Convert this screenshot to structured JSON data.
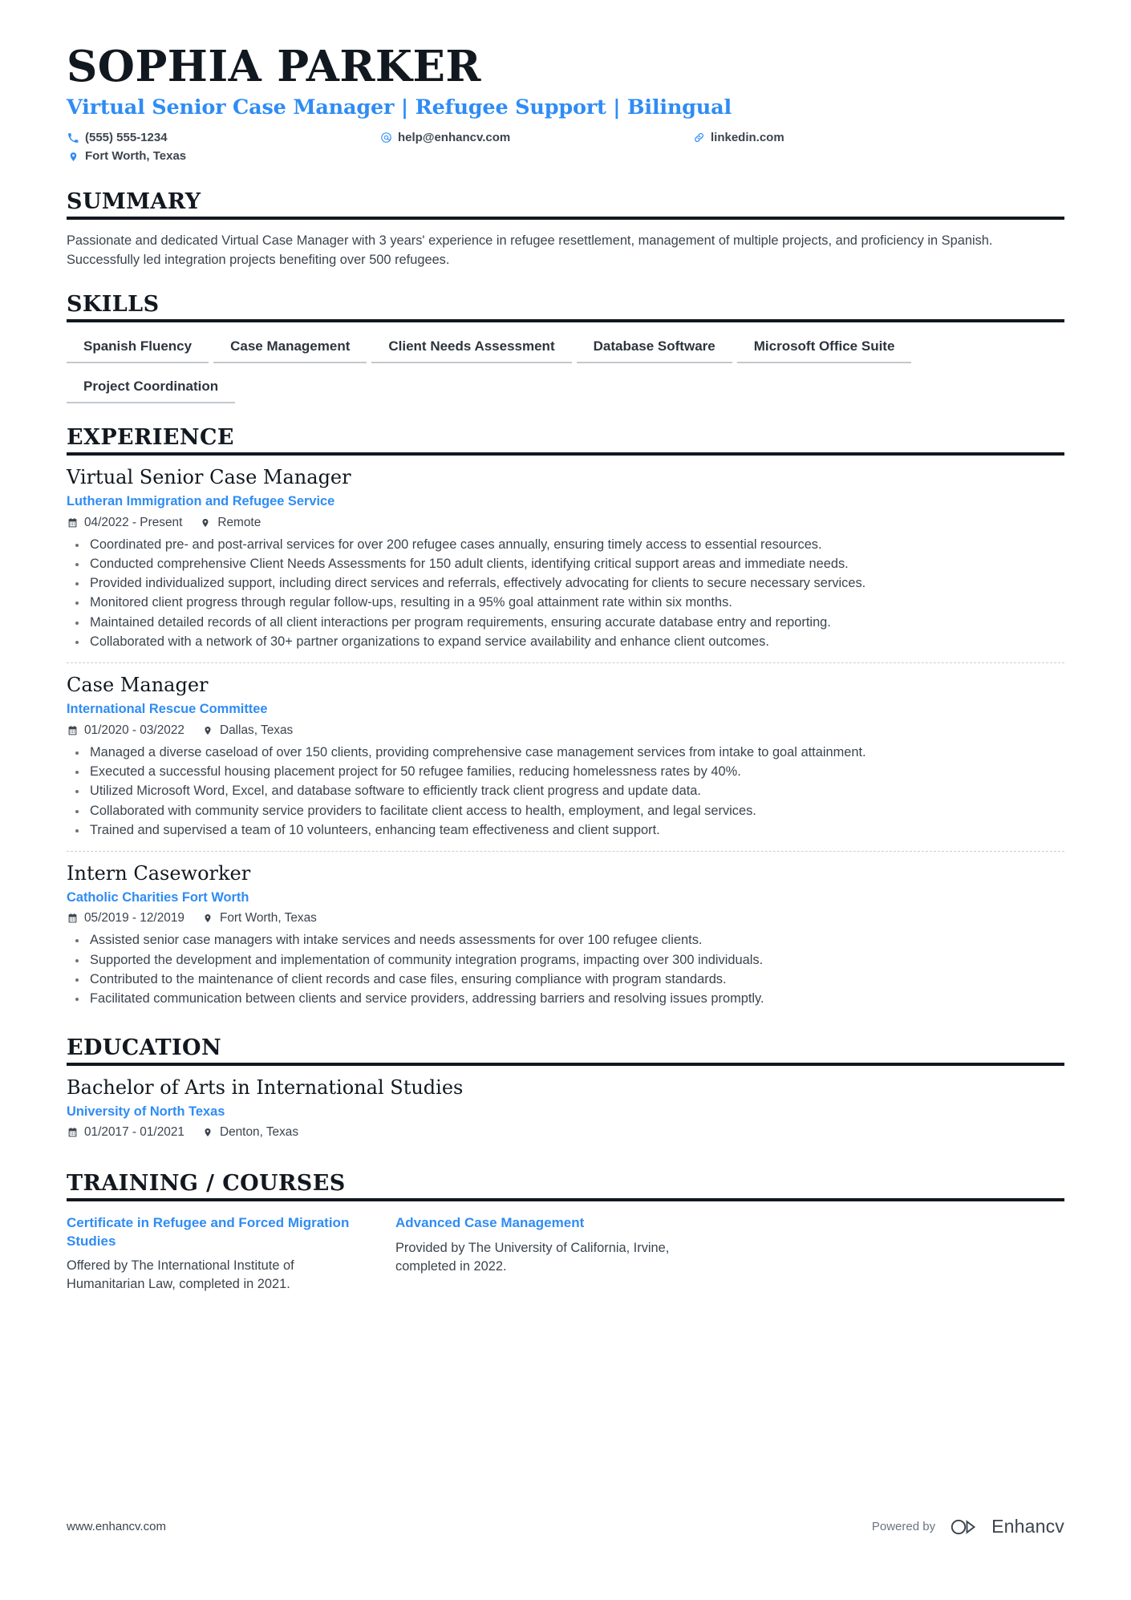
{
  "header": {
    "name": "SOPHIA PARKER",
    "headline": "Virtual Senior Case Manager | Refugee Support | Bilingual",
    "contacts": [
      {
        "icon": "phone-icon",
        "text": "(555) 555-1234"
      },
      {
        "icon": "email-icon",
        "text": "help@enhancv.com"
      },
      {
        "icon": "link-icon",
        "text": "linkedin.com"
      },
      {
        "icon": "location-icon",
        "text": "Fort Worth, Texas"
      }
    ]
  },
  "summary": {
    "title": "SUMMARY",
    "text": "Passionate and dedicated Virtual Case Manager with 3 years' experience in refugee resettlement, management of multiple projects, and proficiency in Spanish. Successfully led integration projects benefiting over 500 refugees."
  },
  "skills": {
    "title": "SKILLS",
    "items": [
      "Spanish Fluency",
      "Case Management",
      "Client Needs Assessment",
      "Database Software",
      "Microsoft Office Suite",
      "Project Coordination"
    ]
  },
  "experience": {
    "title": "EXPERIENCE",
    "entries": [
      {
        "role": "Virtual Senior Case Manager",
        "org": "Lutheran Immigration and Refugee Service",
        "dates": "04/2022 - Present",
        "location": "Remote",
        "bullets": [
          "Coordinated pre- and post-arrival services for over 200 refugee cases annually, ensuring timely access to essential resources.",
          "Conducted comprehensive Client Needs Assessments for 150 adult clients, identifying critical support areas and immediate needs.",
          "Provided individualized support, including direct services and referrals, effectively advocating for clients to secure necessary services.",
          "Monitored client progress through regular follow-ups, resulting in a 95% goal attainment rate within six months.",
          "Maintained detailed records of all client interactions per program requirements, ensuring accurate database entry and reporting.",
          "Collaborated with a network of 30+ partner organizations to expand service availability and enhance client outcomes."
        ]
      },
      {
        "role": "Case Manager",
        "org": "International Rescue Committee",
        "dates": "01/2020 - 03/2022",
        "location": "Dallas, Texas",
        "bullets": [
          "Managed a diverse caseload of over 150 clients, providing comprehensive case management services from intake to goal attainment.",
          "Executed a successful housing placement project for 50 refugee families, reducing homelessness rates by 40%.",
          "Utilized Microsoft Word, Excel, and database software to efficiently track client progress and update data.",
          "Collaborated with community service providers to facilitate client access to health, employment, and legal services.",
          "Trained and supervised a team of 10 volunteers, enhancing team effectiveness and client support."
        ]
      },
      {
        "role": "Intern Caseworker",
        "org": "Catholic Charities Fort Worth",
        "dates": "05/2019 - 12/2019",
        "location": "Fort Worth, Texas",
        "bullets": [
          "Assisted senior case managers with intake services and needs assessments for over 100 refugee clients.",
          "Supported the development and implementation of community integration programs, impacting over 300 individuals.",
          "Contributed to the maintenance of client records and case files, ensuring compliance with program standards.",
          "Facilitated communication between clients and service providers, addressing barriers and resolving issues promptly."
        ]
      }
    ]
  },
  "education": {
    "title": "EDUCATION",
    "entries": [
      {
        "degree": "Bachelor of Arts in International Studies",
        "school": "University of North Texas",
        "dates": "01/2017 - 01/2021",
        "location": "Denton, Texas"
      }
    ]
  },
  "training": {
    "title": "TRAINING / COURSES",
    "courses": [
      {
        "title": "Certificate in Refugee and Forced Migration Studies",
        "description": "Offered by The International Institute of Humanitarian Law, completed in 2021."
      },
      {
        "title": "Advanced Case Management",
        "description": "Provided by The University of California, Irvine, completed in 2022."
      }
    ]
  },
  "footer": {
    "url": "www.enhancv.com",
    "powered_by": "Powered by",
    "brand": "Enhancv"
  },
  "colors": {
    "accent": "#2f8cf4",
    "text": "#3c444e",
    "heading": "#12181f",
    "rule": "#12181f",
    "tag_underline": "#c3c8cd"
  }
}
